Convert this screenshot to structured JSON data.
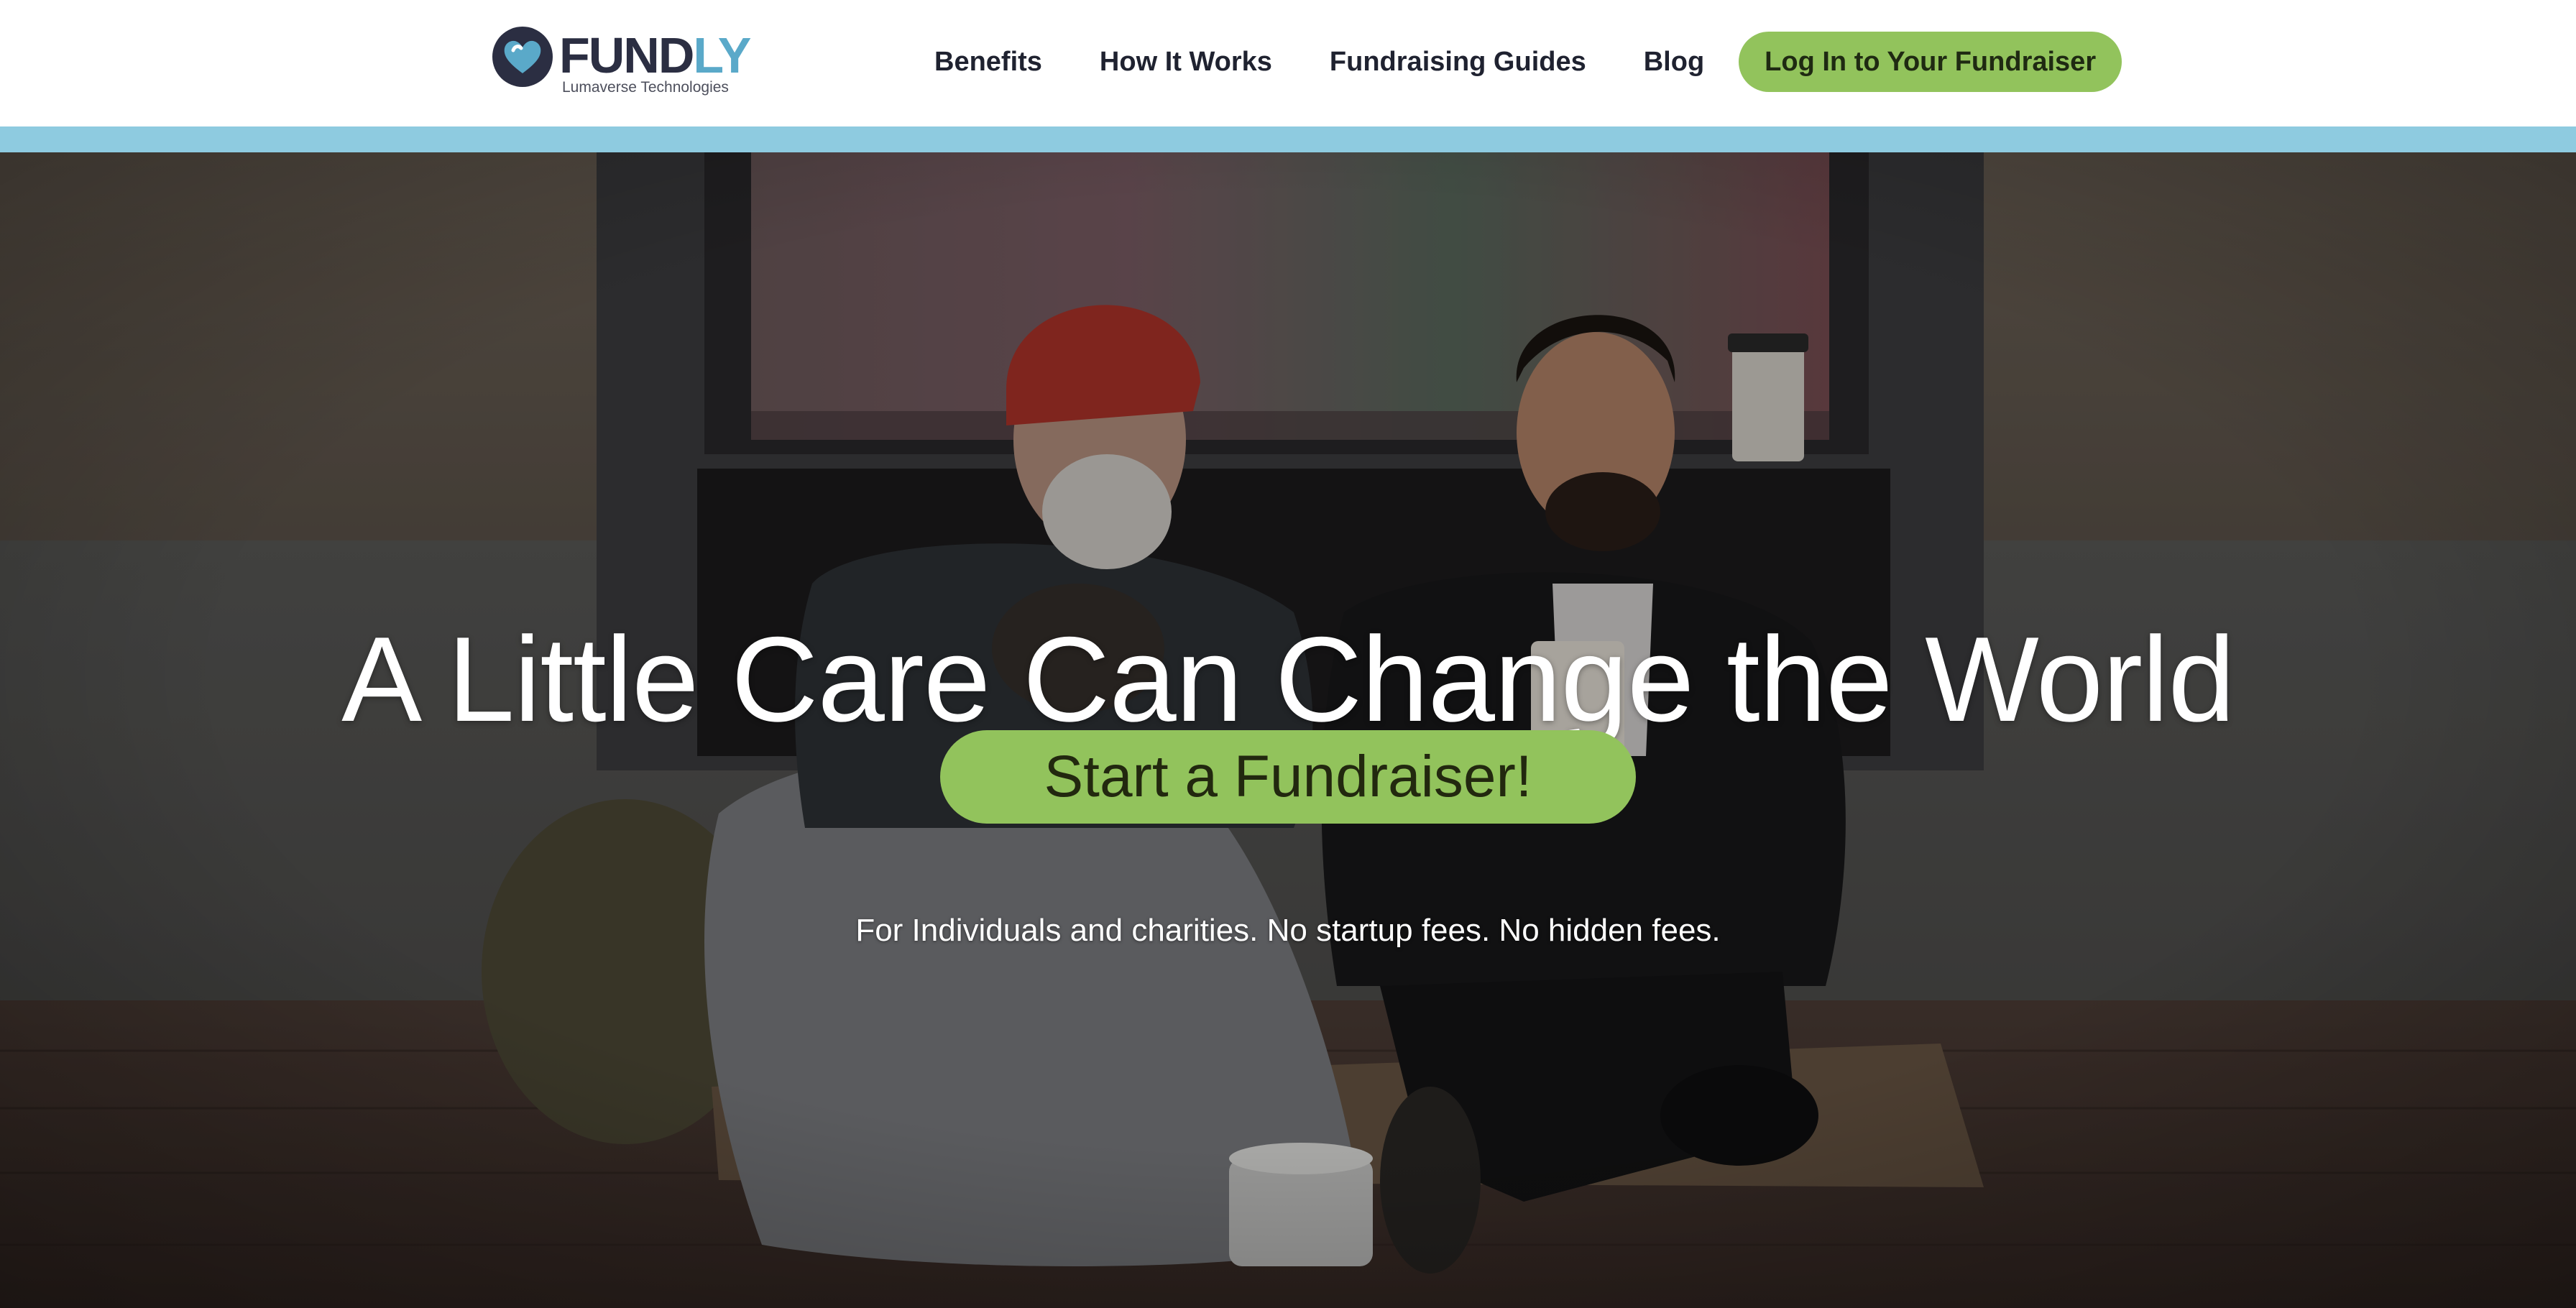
{
  "brand": {
    "logo_text_main": "FUND",
    "logo_text_accent": "LY",
    "logo_subtitle": "Lumaverse Technologies"
  },
  "nav": {
    "items": [
      {
        "label": "Benefits"
      },
      {
        "label": "How It Works"
      },
      {
        "label": "Fundraising Guides"
      },
      {
        "label": "Blog"
      }
    ],
    "login_label": "Log In to Your Fundraiser"
  },
  "hero": {
    "title": "A Little Care Can Change the World",
    "cta_label": "Start a Fundraiser!",
    "subtitle": "For Individuals and charities. No startup fees. No hidden fees.",
    "image_subject": "two-men-sharing-meal-on-sidewalk"
  },
  "colors": {
    "accent_green": "#92c35c",
    "accent_blue_bar": "#8ecbe0",
    "logo_dark": "#2b2e42",
    "logo_light": "#5aa9c9",
    "nav_text": "#1f2230"
  },
  "icons": {
    "logo_mark": "heart-in-circle-icon"
  }
}
